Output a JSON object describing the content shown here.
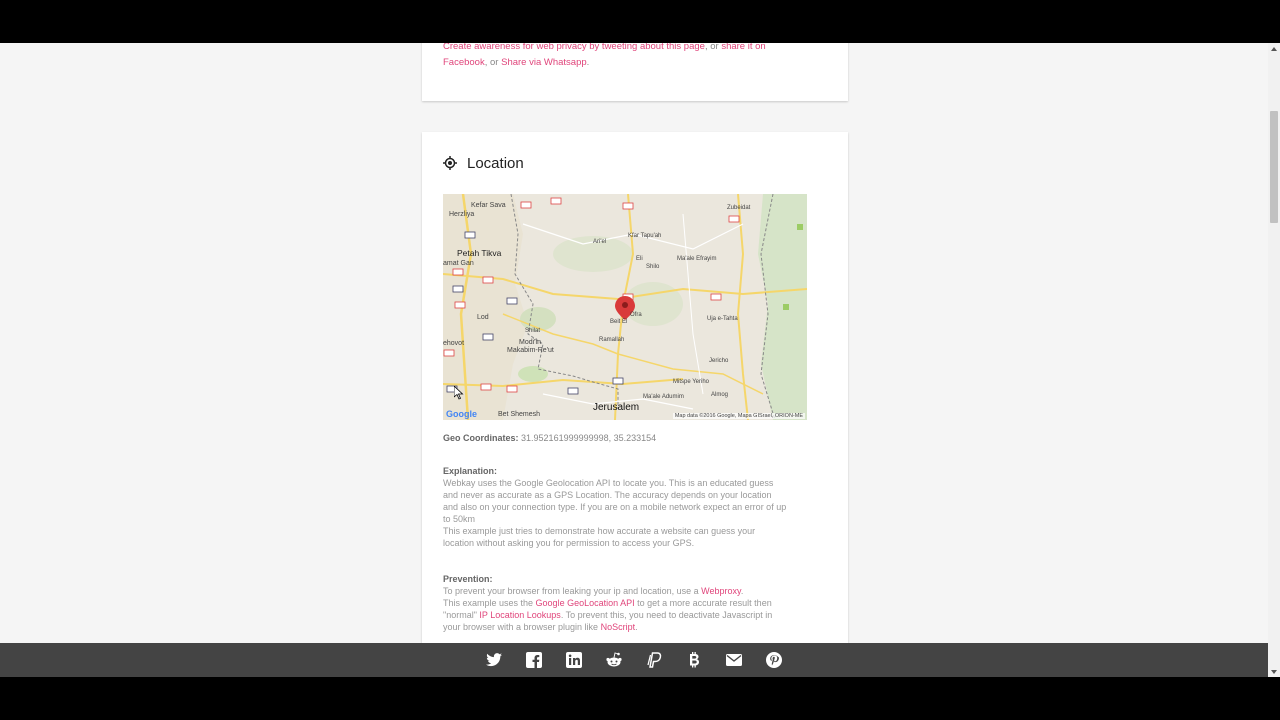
{
  "top_card": {
    "line1_link1": "Create awareness for web privacy by tweeting about this page",
    "line1_sep": ", or ",
    "line1_link2": "share it on",
    "line2_link1": "Facebook",
    "line2_sep": ", or ",
    "line2_link2": "Share via Whatsapp",
    "line2_end": "."
  },
  "location": {
    "title": "Location",
    "icon": "crosshair-icon",
    "geo_label": "Geo Coordinates:",
    "geo_value": "31.952161999999998, 35.233154",
    "explanation_head": "Explanation:",
    "explanation_lines": [
      "Webkay uses the Google Geolocation API to locate you. This is an educated guess",
      "and never as accurate as a GPS Location. The accuracy depends on your location",
      "and also on your connection type. If you are on a mobile network expect an error of up",
      "to 50km",
      "This example just tries to demonstrate how accurate a website can guess your",
      "location without asking you for permission to access your GPS."
    ],
    "prevention_head": "Prevention:",
    "prev_l1_text": "To prevent your browser from leaking your ip and location, use a ",
    "prev_l1_link": "Webproxy",
    "prev_l1_end": ".",
    "prev_l2_text": "This example uses the ",
    "prev_l2_link": "Google GeoLocation API",
    "prev_l2_end": " to get a more accurate result then",
    "prev_l3_text": "\"normal\" ",
    "prev_l3_link": "IP Location Lookups",
    "prev_l3_end": ". To prevent this, you need to deactivate Javascript in",
    "prev_l4_text": "your browser with a browser plugin like ",
    "prev_l4_link": "NoScript",
    "prev_l4_end": "."
  },
  "map": {
    "attribution": "Map data ©2016 Google, Mapa GISrael, ORION-ME",
    "google": "Google",
    "places": {
      "kefar_sava": "Kefar Sava",
      "herzliya": "Herzliya",
      "petah_tikva": "Petah Tikva",
      "ramat_gan": "amat Gan",
      "lod": "Lod",
      "rehovot": "ehovot",
      "shilat": "Shilat",
      "modiin": "Modi'in",
      "makabim": "Makabim-Re'ut",
      "bet_shemesh": "Bet Shemesh",
      "jerusalem": "Jerusalem",
      "ariel": "Ari'el",
      "kfar_tapuah": "Kfar Tapu'ah",
      "eli": "Eli",
      "shilo": "Shilo",
      "maale_efraim": "Ma'ale Efrayim",
      "bet_el": "Beit El",
      "ofra": "Ofra",
      "ramallah": "Ramallah",
      "uja": "Uja e-Tahta",
      "jericho": "Jericho",
      "mitspe_yeriho": "Mitspe Yeriho",
      "maale_adumim": "Ma'ale Adumim",
      "almog": "Almog",
      "zubeidat": "Zubeidat"
    }
  },
  "share_icons": [
    "twitter-icon",
    "facebook-icon",
    "linkedin-icon",
    "reddit-icon",
    "paypal-icon",
    "bitcoin-icon",
    "email-icon",
    "pinterest-icon"
  ],
  "colors": {
    "link": "#e0457b",
    "sharebar": "#444444",
    "marker": "#d93a3a"
  }
}
